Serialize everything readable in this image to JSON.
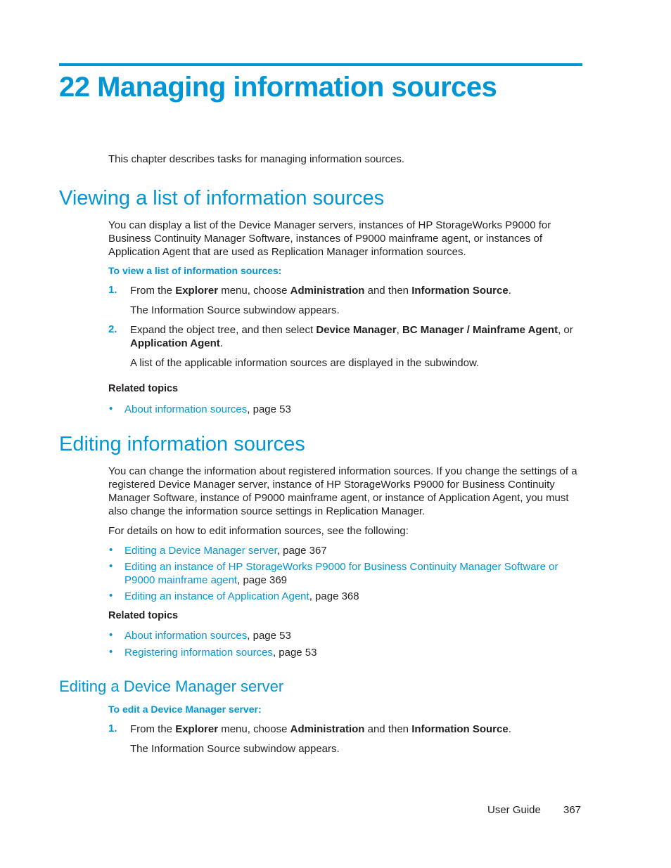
{
  "chapter": {
    "number": "22",
    "title": "22 Managing information sources"
  },
  "intro": "This chapter describes tasks for managing information sources.",
  "sections": [
    {
      "heading": "Viewing a list of information sources",
      "body": "You can display a list of the Device Manager servers, instances of HP StorageWorks P9000 for Business Continuity Manager Software, instances of P9000 mainframe agent, or instances of Application Agent that are used as Replication Manager information sources.",
      "procedure_title": "To view a list of information sources:",
      "steps": [
        {
          "num": "1.",
          "t1": "From the ",
          "b1": "Explorer",
          "t2": " menu, choose ",
          "b2": "Administration",
          "t3": " and then ",
          "b3": "Information Source",
          "t4": ".",
          "result": "The Information Source subwindow appears."
        },
        {
          "num": "2.",
          "t1": "Expand the object tree, and then select ",
          "b1": "Device Manager",
          "t2": ", ",
          "b2": "BC Manager / Mainframe Agent",
          "t3": ", or ",
          "b3": "Application Agent",
          "t4": ".",
          "result": "A list of the applicable information sources are displayed in the subwindow."
        }
      ],
      "related_label": "Related topics",
      "related": [
        {
          "link": "About information sources",
          "suffix": ", page 53"
        }
      ]
    },
    {
      "heading": "Editing information sources",
      "body": "You can change the information about registered information sources. If you change the settings of a registered Device Manager server, instance of HP StorageWorks P9000 for Business Continuity Manager Software, instance of P9000 mainframe agent, or instance of Application Agent, you must also change the information source settings in Replication Manager.",
      "body2": "For details on how to edit information sources, see the following:",
      "links": [
        {
          "link": "Editing a Device Manager server",
          "suffix": ", page 367"
        },
        {
          "link": "Editing an instance of HP StorageWorks P9000 for Business Continuity Manager Software or P9000 mainframe agent",
          "suffix": ", page 369"
        },
        {
          "link": "Editing an instance of Application Agent",
          "suffix": ", page 368"
        }
      ],
      "related_label": "Related topics",
      "related": [
        {
          "link": "About information sources",
          "suffix": ", page 53"
        },
        {
          "link": "Registering information sources",
          "suffix": ", page 53"
        }
      ]
    },
    {
      "heading": "Editing a Device Manager server",
      "procedure_title": "To edit a Device Manager server:",
      "steps": [
        {
          "num": "1.",
          "t1": "From the ",
          "b1": "Explorer",
          "t2": " menu, choose ",
          "b2": "Administration",
          "t3": " and then ",
          "b3": "Information Source",
          "t4": ".",
          "result": "The Information Source subwindow appears."
        }
      ]
    }
  ],
  "footer": {
    "label": "User Guide",
    "page": "367"
  },
  "bullet_glyph": "•",
  "colors": {
    "accent": "#0096d6",
    "text": "#231f20"
  }
}
